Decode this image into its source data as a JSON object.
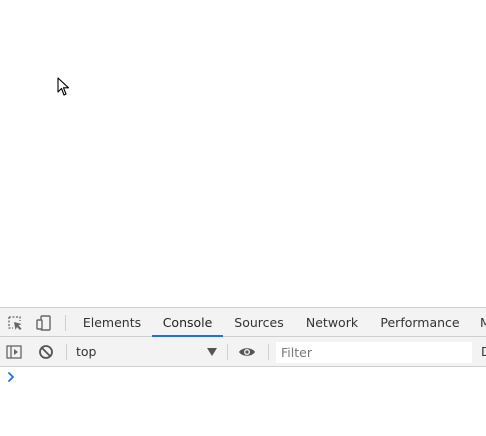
{
  "devtools": {
    "tabs": [
      {
        "label": "Elements",
        "active": false
      },
      {
        "label": "Console",
        "active": true
      },
      {
        "label": "Sources",
        "active": false
      },
      {
        "label": "Network",
        "active": false
      },
      {
        "label": "Performance",
        "active": false
      },
      {
        "label": "M",
        "active": false
      }
    ],
    "toolbar": {
      "context_value": "top",
      "filter_placeholder": "Filter",
      "clipped_label": "D"
    },
    "icons": {
      "inspect": "inspect-element-icon",
      "device": "device-toolbar-icon",
      "sidebar": "show-console-sidebar-icon",
      "clear": "clear-console-icon",
      "eye": "live-expression-icon",
      "prompt": "console-prompt-chevron-icon"
    },
    "colors": {
      "accent": "#1a73e8",
      "toolbar_bg": "#f3f3f3",
      "border": "#cfcfcf"
    }
  }
}
